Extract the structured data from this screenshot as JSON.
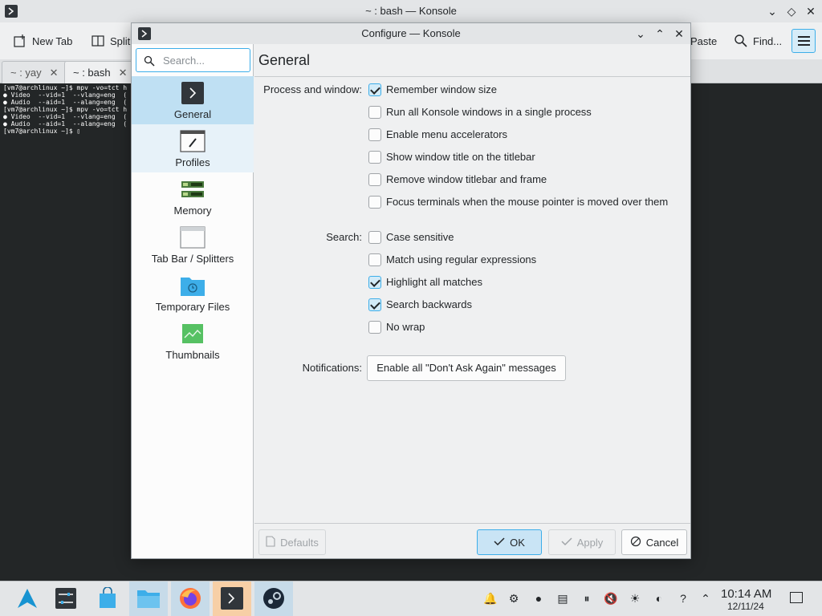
{
  "konsole": {
    "title": "~ : bash — Konsole",
    "toolbar": {
      "new_tab": "New Tab",
      "split": "Split",
      "paste": "Paste",
      "find": "Find..."
    },
    "tabs": [
      {
        "label": "~ : yay",
        "active": false
      },
      {
        "label": "~ : bash",
        "active": true
      }
    ],
    "terminal_lines": [
      "[vm7@archlinux ~]$ mpv -vo=tct h",
      "● Video  --vid=1  --vlang=eng  (",
      "● Audio  --aid=1  --alang=eng  (",
      "[vm7@archlinux ~]$ mpv -vo=tct h",
      "● Video  --vid=1  --vlang=eng  (",
      "● Audio  --aid=1  --alang=eng  (",
      "[vm7@archlinux ~]$ ▯"
    ]
  },
  "dialog": {
    "title": "Configure — Konsole",
    "search_placeholder": "Search...",
    "nav": [
      {
        "label": "General",
        "icon": "general-icon",
        "selected": true
      },
      {
        "label": "Profiles",
        "icon": "profiles-icon",
        "selected": false
      },
      {
        "label": "Memory",
        "icon": "memory-icon",
        "selected": false
      },
      {
        "label": "Tab Bar / Splitters",
        "icon": "tabbar-icon",
        "selected": false
      },
      {
        "label": "Temporary Files",
        "icon": "folder-icon",
        "selected": false
      },
      {
        "label": "Thumbnails",
        "icon": "thumbnails-icon",
        "selected": false
      }
    ],
    "page_title": "General",
    "process_label": "Process and window:",
    "process_options": [
      {
        "label": "Remember window size",
        "checked": true
      },
      {
        "label": "Run all Konsole windows in a single process",
        "checked": false
      },
      {
        "label": "Enable menu accelerators",
        "checked": false
      },
      {
        "label": "Show window title on the titlebar",
        "checked": false
      },
      {
        "label": "Remove window titlebar and frame",
        "checked": false
      },
      {
        "label": "Focus terminals when the mouse pointer is moved over them",
        "checked": false
      }
    ],
    "search_label": "Search:",
    "search_options": [
      {
        "label": "Case sensitive",
        "checked": false
      },
      {
        "label": "Match using regular expressions",
        "checked": false
      },
      {
        "label": "Highlight all matches",
        "checked": true
      },
      {
        "label": "Search backwards",
        "checked": true
      },
      {
        "label": "No wrap",
        "checked": false
      }
    ],
    "notifications_label": "Notifications:",
    "notifications_button": "Enable all \"Don't Ask Again\" messages",
    "buttons": {
      "defaults": "Defaults",
      "ok": "OK",
      "apply": "Apply",
      "cancel": "Cancel"
    }
  },
  "panel": {
    "time": "10:14 AM",
    "date": "12/11/24"
  },
  "colors": {
    "accent": "#3daee9",
    "selection": "#bfe0f3",
    "terminal_bg": "#232627"
  }
}
